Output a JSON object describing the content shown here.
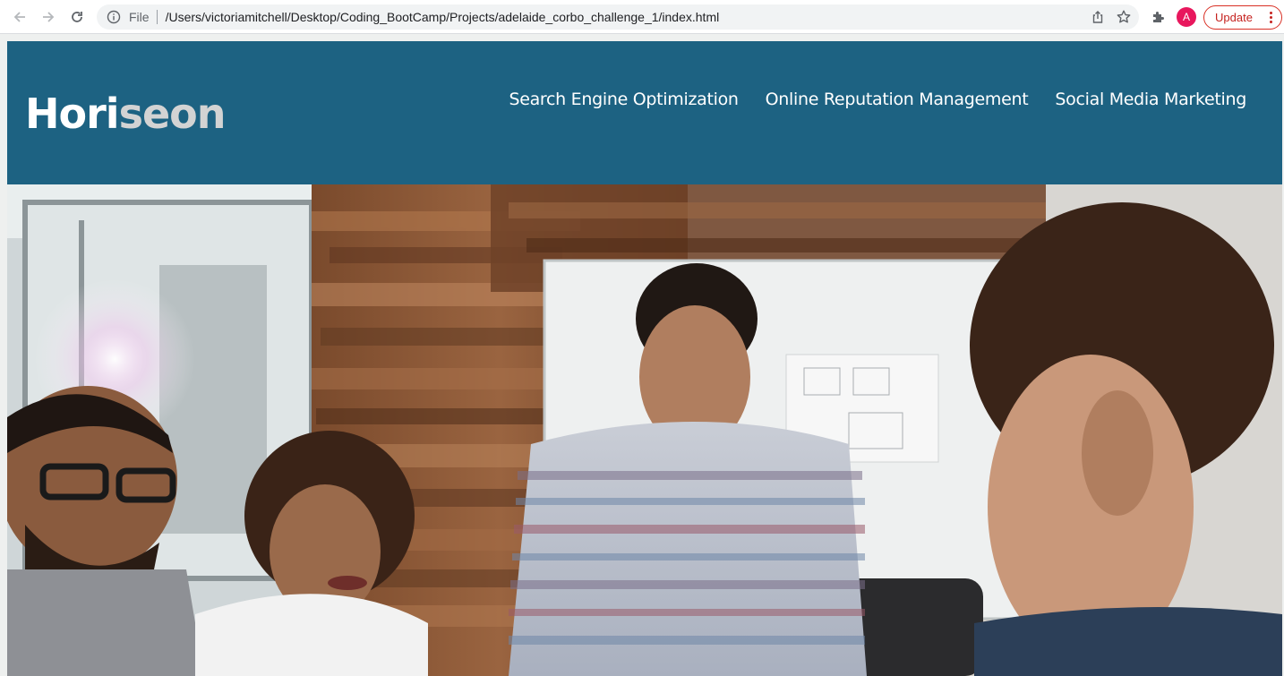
{
  "browser": {
    "scheme_label": "File",
    "url": "/Users/victoriamitchell/Desktop/Coding_BootCamp/Projects/adelaide_corbo_challenge_1/index.html",
    "profile_initial": "A",
    "update_label": "Update",
    "icons": [
      "back-arrow-icon",
      "forward-arrow-icon",
      "reload-icon",
      "info-icon",
      "share-icon",
      "star-icon",
      "puzzle-icon",
      "more-vert-icon"
    ]
  },
  "site": {
    "logo_part1": "Hori",
    "logo_part2": "seon",
    "nav": [
      {
        "label": "Search Engine Optimization"
      },
      {
        "label": "Online Reputation Management"
      },
      {
        "label": "Social Media Marketing"
      }
    ],
    "hero_image": "office-meeting-photo"
  },
  "colors": {
    "header_bg": "#1d6282",
    "logo_accent": "#d3d3d3",
    "update_red": "#d93025",
    "avatar_pink": "#e8175d"
  }
}
